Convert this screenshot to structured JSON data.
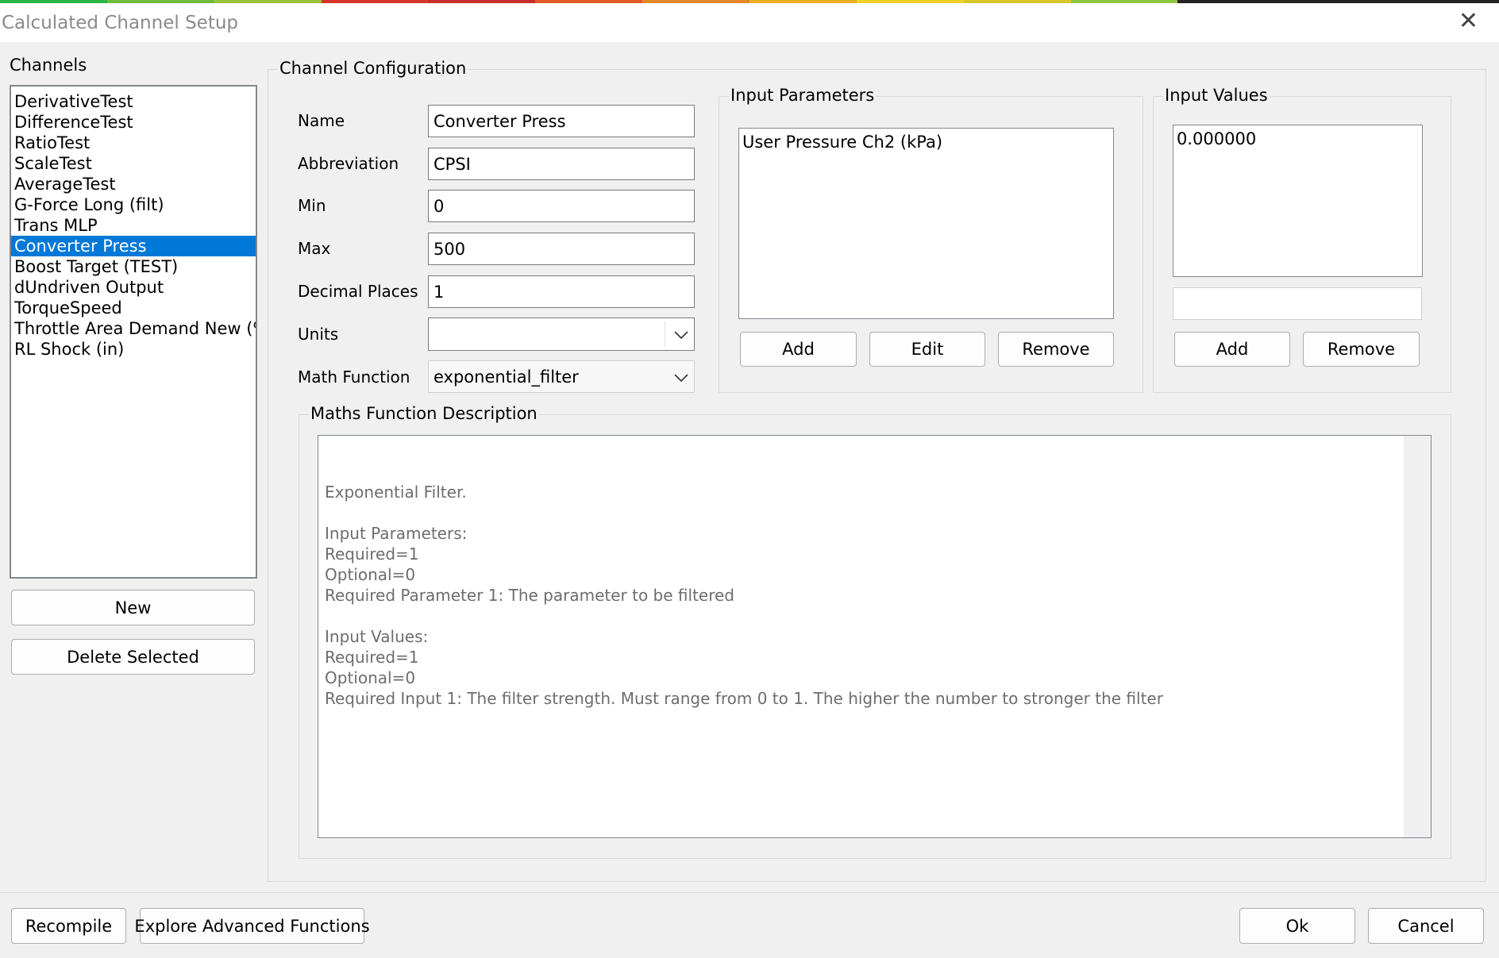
{
  "window": {
    "title": "Calculated Channel Setup",
    "close_symbol": "✕",
    "top_strip_colors": [
      "#2bb544",
      "#6dbb3a",
      "#9ac43a",
      "#d6342c",
      "#c72d2a",
      "#e15b2a",
      "#e28a2b",
      "#eab127",
      "#f0cf2b",
      "#d7c52a",
      "#8dc63f",
      "#222222",
      "#222222",
      "#222222"
    ]
  },
  "channels": {
    "label": "Channels",
    "items": [
      "DerivativeTest",
      "DifferenceTest",
      "RatioTest",
      "ScaleTest",
      "AverageTest",
      "G-Force Long (filt)",
      "Trans MLP",
      "Converter Press",
      "Boost Target (TEST)",
      "dUndriven Output",
      "TorqueSpeed",
      "Throttle Area Demand New (%)",
      "RL Shock (in)"
    ],
    "selected": "Converter Press",
    "new_label": "New",
    "delete_label": "Delete Selected"
  },
  "config": {
    "label": "Channel Configuration",
    "name_label": "Name",
    "name_value": "Converter Press",
    "abbr_label": "Abbreviation",
    "abbr_value": "CPSI",
    "min_label": "Min",
    "min_value": "0",
    "max_label": "Max",
    "max_value": "500",
    "decimal_label": "Decimal Places",
    "decimal_value": "1",
    "units_label": "Units",
    "units_value": "",
    "math_label": "Math Function",
    "math_value": "exponential_filter"
  },
  "input_parameters": {
    "label": "Input Parameters",
    "items": [
      "User Pressure Ch2 (kPa)"
    ],
    "add_label": "Add",
    "edit_label": "Edit",
    "remove_label": "Remove"
  },
  "input_values": {
    "label": "Input Values",
    "items": [
      "0.000000"
    ],
    "entry_value": "",
    "add_label": "Add",
    "remove_label": "Remove"
  },
  "description": {
    "label": "Maths Function Description",
    "text": "Exponential Filter.\n\nInput Parameters:\nRequired=1\nOptional=0\nRequired Parameter 1: The parameter to be filtered\n\nInput Values:\nRequired=1\nOptional=0\nRequired Input 1: The filter strength. Must range from 0 to 1. The higher the number to stronger the filter"
  },
  "footer": {
    "recompile_label": "Recompile",
    "explore_label": "Explore Advanced Functions",
    "ok_label": "Ok",
    "cancel_label": "Cancel"
  }
}
